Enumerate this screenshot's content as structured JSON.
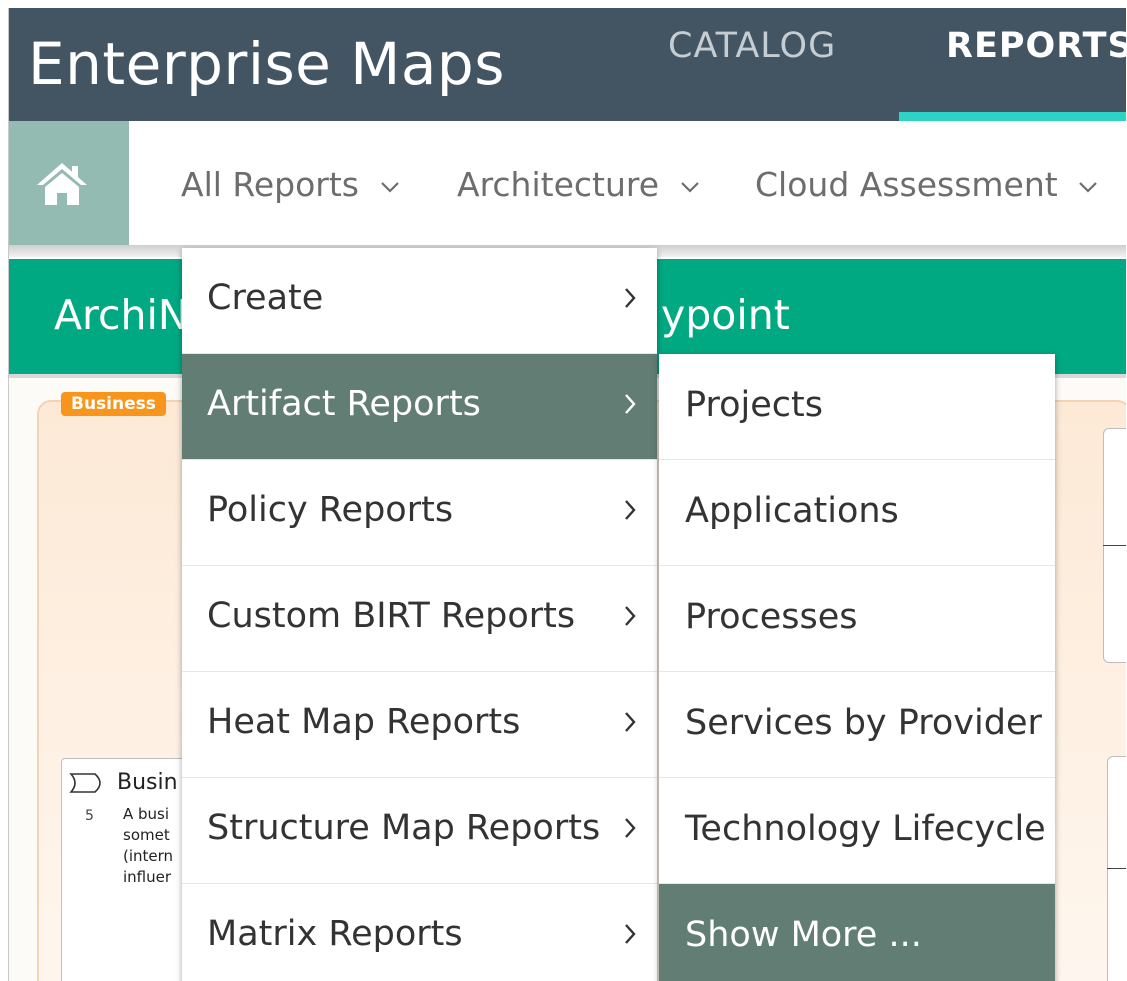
{
  "header": {
    "app_title": "Enterprise Maps",
    "tabs": [
      {
        "label": "CATALOG"
      },
      {
        "label": "REPORTS"
      }
    ]
  },
  "subnav": {
    "items": [
      {
        "label": "All Reports"
      },
      {
        "label": "Architecture"
      },
      {
        "label": "Cloud Assessment"
      }
    ]
  },
  "page": {
    "title_left": "ArchiN",
    "title_right": "ypoint"
  },
  "canvas": {
    "badge": "Business",
    "card": {
      "title": "Busin",
      "number": "5",
      "lines": [
        "A busi",
        "somet",
        "(intern",
        "influer"
      ]
    }
  },
  "menu": {
    "items": [
      {
        "label": "Create"
      },
      {
        "label": "Artifact Reports"
      },
      {
        "label": "Policy Reports"
      },
      {
        "label": "Custom BIRT Reports"
      },
      {
        "label": "Heat Map Reports"
      },
      {
        "label": "Structure Map Reports"
      },
      {
        "label": "Matrix Reports"
      }
    ],
    "active": "Artifact Reports"
  },
  "submenu": {
    "items": [
      {
        "label": "Projects"
      },
      {
        "label": "Applications"
      },
      {
        "label": "Processes"
      },
      {
        "label": "Services by Provider"
      },
      {
        "label": "Technology Lifecycle"
      },
      {
        "label": "Show More ..."
      }
    ],
    "active": "Show More ..."
  },
  "colors": {
    "header_bg": "#435563",
    "accent_underline": "#2ed3c6",
    "home_bg": "#93bbb1",
    "green_band": "#01a982",
    "menu_active": "#627d74",
    "badge_orange": "#f7951d"
  }
}
